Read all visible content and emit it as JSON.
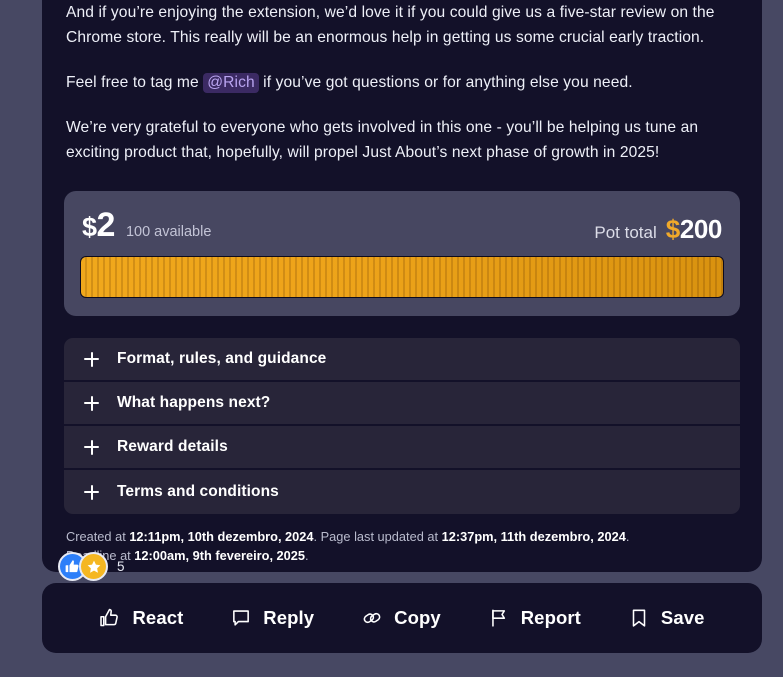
{
  "post": {
    "paragraphs": [
      {
        "segments": [
          {
            "type": "text",
            "text": "And if you’re enjoying the extension, we’d love it if you could give us a five-star review on the Chrome store. This really will be an enormous help in getting us some crucial early traction."
          }
        ]
      },
      {
        "segments": [
          {
            "type": "text",
            "text": "Feel free to tag me "
          },
          {
            "type": "mention",
            "text": "@Rich"
          },
          {
            "type": "text",
            "text": " if you’ve got questions or for anything else you need."
          }
        ]
      },
      {
        "segments": [
          {
            "type": "text",
            "text": "We’re very grateful to everyone who gets involved in this one - you’ll be helping us tune an exciting product that, hopefully, will propel Just About’s next phase of growth in 2025!"
          }
        ]
      }
    ]
  },
  "pot": {
    "currency_symbol": "$",
    "reward_amount": "2",
    "available_label": "100 available",
    "available_count": 100,
    "pot_total_label": "Pot total",
    "pot_total_value": "200",
    "progress_percent": 100,
    "segments": 100,
    "colors": {
      "bar_start": "#f0a81c",
      "bar_end": "#d9920f",
      "panel_bg": "#474761",
      "accent": "#f0a92a"
    }
  },
  "accordion": {
    "items": [
      {
        "label": "Format, rules, and guidance",
        "icon": "plus-icon",
        "expanded": false
      },
      {
        "label": "What happens next?",
        "icon": "plus-icon",
        "expanded": false
      },
      {
        "label": "Reward details",
        "icon": "plus-icon",
        "expanded": false
      },
      {
        "label": "Terms and conditions",
        "icon": "plus-icon",
        "expanded": false
      }
    ]
  },
  "meta": {
    "created_prefix": "Created at ",
    "created_at": "12:11pm, 10th dezembro, 2024",
    "updated_prefix": ". Page last updated at ",
    "updated_at": "12:37pm, 11th dezembro, 2024",
    "updated_suffix": ".",
    "deadline_prefix": "Deadline at ",
    "deadline_at": "12:00am, 9th fevereiro, 2025",
    "deadline_suffix": "."
  },
  "reactions": {
    "count": "5",
    "chips": [
      {
        "icon": "thumbs-up-icon",
        "color": "#2d7ff9"
      },
      {
        "icon": "star-icon",
        "color": "#f5b722"
      }
    ]
  },
  "actions": {
    "items": [
      {
        "label": "React",
        "icon": "thumbs-up-icon"
      },
      {
        "label": "Reply",
        "icon": "speech-bubble-icon"
      },
      {
        "label": "Copy",
        "icon": "link-icon"
      },
      {
        "label": "Report",
        "icon": "flag-icon"
      },
      {
        "label": "Save",
        "icon": "bookmark-icon"
      }
    ]
  }
}
